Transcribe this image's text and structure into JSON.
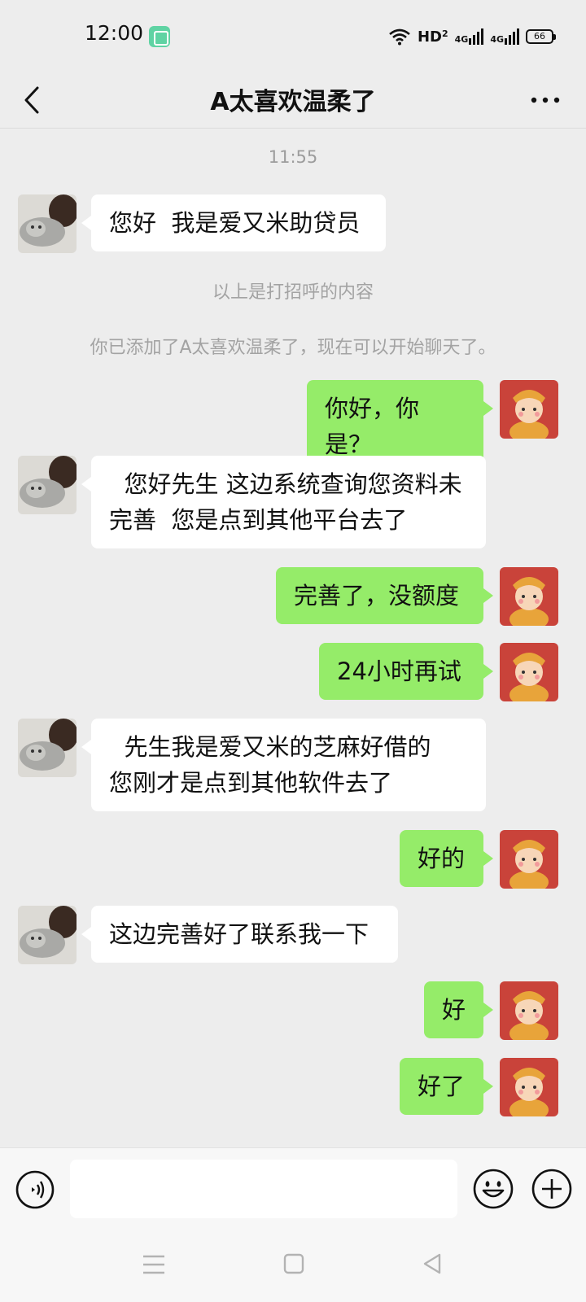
{
  "status_bar": {
    "time": "12:00",
    "network": "HD",
    "network_sub": "2",
    "sig1": "4G",
    "sig2": "4G",
    "battery": "66"
  },
  "header": {
    "title": "A太喜欢温柔了",
    "back_icon": "chevron-left-icon",
    "more_icon": "more-dots-icon"
  },
  "chat": {
    "timestamp": "11:55",
    "messages": [
      {
        "side": "left",
        "text": "您好  我是爱又米助贷员"
      },
      {
        "side": "system",
        "text": "以上是打招呼的内容"
      },
      {
        "side": "system",
        "text": "你已添加了A太喜欢温柔了，现在可以开始聊天了。"
      },
      {
        "side": "right",
        "text": "你好，你是？"
      },
      {
        "side": "left",
        "text": "  您好先生 这边系统查询您资料未完善  您是点到其他平台去了"
      },
      {
        "side": "right",
        "text": "完善了，没额度"
      },
      {
        "side": "right",
        "text": "24小时再试"
      },
      {
        "side": "left",
        "text": "  先生我是爱又米的芝麻好借的  您刚才是点到其他软件去了"
      },
      {
        "side": "right",
        "text": "好的"
      },
      {
        "side": "left",
        "text": "这边完善好了联系我一下"
      },
      {
        "side": "right",
        "text": "好"
      },
      {
        "side": "right",
        "text": "好了"
      }
    ]
  },
  "input_bar": {
    "value": "",
    "voice_icon": "voice-icon",
    "emoji_icon": "emoji-icon",
    "plus_icon": "plus-icon"
  },
  "nav_bar": {
    "menu_icon": "menu-icon",
    "home_icon": "home-icon",
    "back_icon": "back-triangle-icon"
  },
  "colors": {
    "background": "#ededed",
    "bubble_right": "#95ec69",
    "bubble_left": "#ffffff",
    "system_text": "#a3a3a3"
  }
}
